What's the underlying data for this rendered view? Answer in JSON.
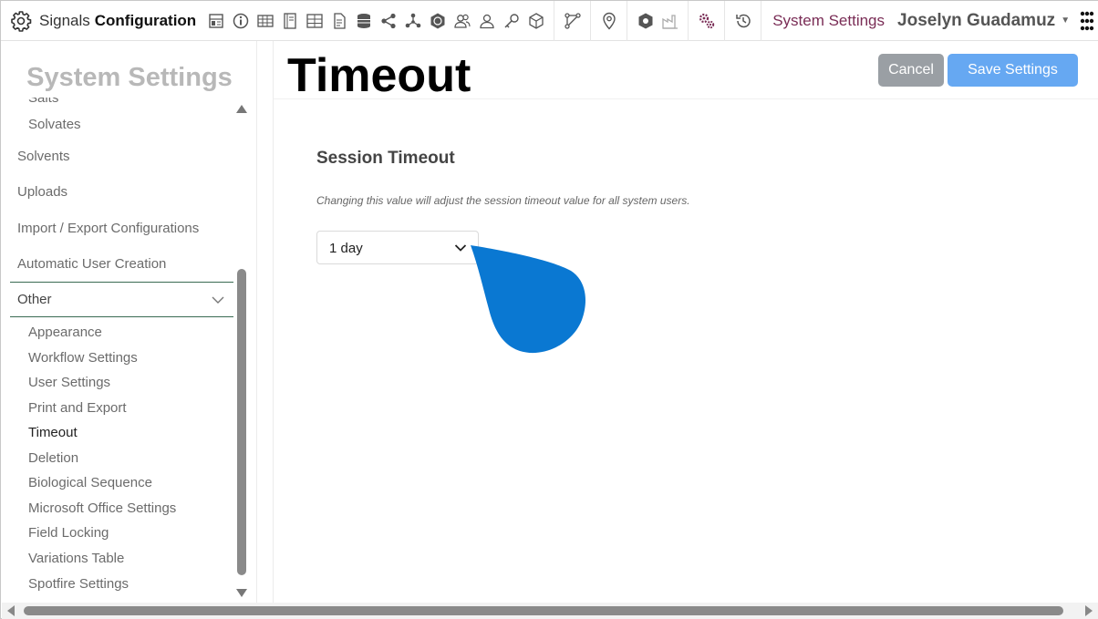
{
  "app": {
    "title_light": "Signals",
    "title_bold": "Configuration"
  },
  "toolbar": {
    "icons": [
      "dashboard-icon",
      "info-icon",
      "table-icon",
      "notebook-icon",
      "grid-icon",
      "document-icon",
      "database-icon",
      "share-icon",
      "network-icon",
      "hexagon-badge-icon",
      "users-icon",
      "user-icon",
      "key-icon",
      "cube-icon",
      "workflow-icon",
      "location-pin-icon",
      "shield-box-icon",
      "factory-icon",
      "gears-icon",
      "history-icon"
    ],
    "system_settings_link": "System Settings",
    "user_name": "Joselyn Guadamuz"
  },
  "sidebar": {
    "title": "System Settings",
    "items_top": [
      {
        "label": "Salts",
        "level": 2
      },
      {
        "label": "Solvates",
        "level": 2
      },
      {
        "label": "Solvents",
        "level": 1
      },
      {
        "label": "Uploads",
        "level": 1
      },
      {
        "label": "Import / Export Configurations",
        "level": 1
      },
      {
        "label": "Automatic User Creation",
        "level": 1
      }
    ],
    "group": {
      "label": "Other"
    },
    "subitems": [
      "Appearance",
      "Workflow Settings",
      "User Settings",
      "Print and Export",
      "Timeout",
      "Deletion",
      "Biological Sequence",
      "Microsoft Office Settings",
      "Field Locking",
      "Variations Table",
      "Spotfire Settings"
    ],
    "active_item": "Timeout"
  },
  "main": {
    "page_title": "Timeout",
    "cancel_label": "Cancel",
    "save_label": "Save Settings",
    "section_title": "Session Timeout",
    "hint": "Changing this value will adjust the session timeout value for all system users.",
    "timeout_value": "1 day"
  },
  "colors": {
    "accent_link": "#7a2d56",
    "save_button": "#66a8f2",
    "cancel_button": "#9a9fa4",
    "pointer_blob": "#0a78d2",
    "divider": "#3a6b53"
  }
}
